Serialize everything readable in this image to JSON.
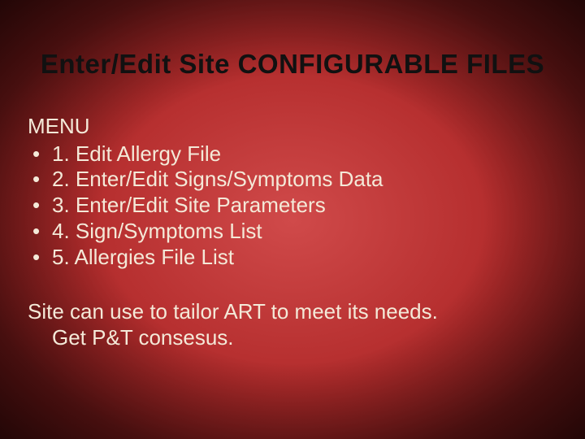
{
  "title": "Enter/Edit Site CONFIGURABLE FILES",
  "menu_label": "MENU",
  "menu": {
    "items": [
      {
        "label": "1. Edit Allergy File"
      },
      {
        "label": "2. Enter/Edit Signs/Symptoms Data"
      },
      {
        "label": "3. Enter/Edit Site Parameters"
      },
      {
        "label": "4. Sign/Symptoms List"
      },
      {
        "label": "5. Allergies File List"
      }
    ]
  },
  "footnote": {
    "line1": "Site can use to tailor ART to meet its needs.",
    "line2": "Get P&T consesus."
  }
}
